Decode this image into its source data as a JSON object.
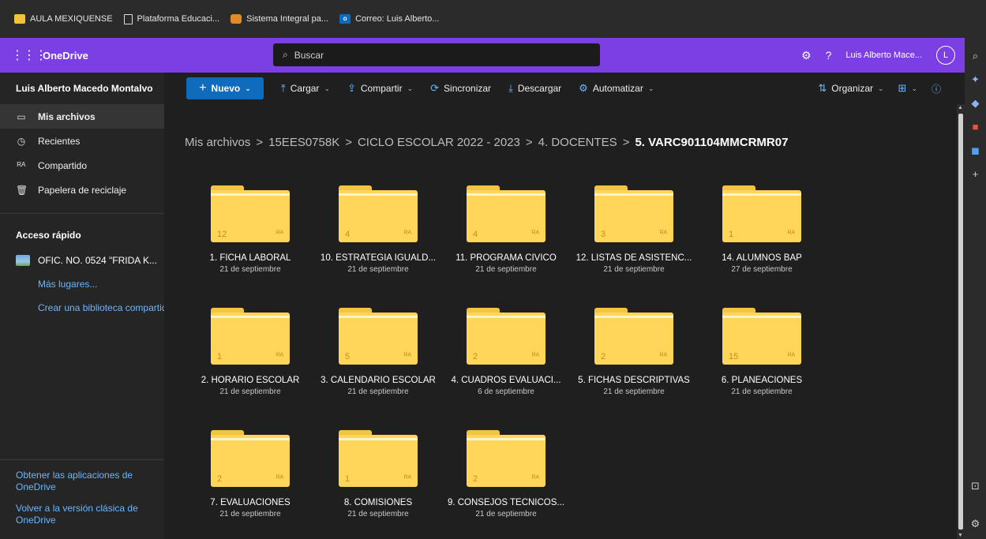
{
  "bookmarks": [
    {
      "label": "AULA MEXIQUENSE",
      "icon": "folder-icon"
    },
    {
      "label": "Plataforma Educaci...",
      "icon": "page-icon"
    },
    {
      "label": "Sistema Integral pa...",
      "icon": "school-icon"
    },
    {
      "label": "Correo: Luis Alberto...",
      "icon": "outlook-icon"
    }
  ],
  "header": {
    "app_name": "OneDrive",
    "search_placeholder": "Buscar",
    "help": "?",
    "user_name": "Luis Alberto Mace...",
    "avatar_initial": "L"
  },
  "sidebar": {
    "user": "Luis Alberto Macedo Montalvo",
    "items": [
      {
        "label": "Mis archivos",
        "icon": "folder-icon",
        "selected": true
      },
      {
        "label": "Recientes",
        "icon": "clock-icon"
      },
      {
        "label": "Compartido",
        "icon": "people-icon"
      },
      {
        "label": "Papelera de reciclaje",
        "icon": "trash-icon"
      }
    ],
    "quick_access_title": "Acceso rápido",
    "quick_item": "OFIC. NO. 0524 \"FRIDA K...",
    "more_places": "Más lugares...",
    "create_library": "Crear una biblioteca compartida",
    "get_apps": "Obtener las aplicaciones de OneDrive",
    "classic": "Volver a la versión clásica de OneDrive"
  },
  "commands": {
    "new": "Nuevo",
    "upload": "Cargar",
    "share": "Compartir",
    "sync": "Sincronizar",
    "download": "Descargar",
    "automate": "Automatizar",
    "organize": "Organizar"
  },
  "breadcrumb": {
    "items": [
      "Mis archivos",
      "15EES0758K",
      "CICLO ESCOLAR 2022 - 2023",
      "4. DOCENTES"
    ],
    "current": "5. VARC901104MMCRMR07"
  },
  "folders": [
    {
      "name": "1. FICHA LABORAL",
      "date": "21 de septiembre",
      "count": "12"
    },
    {
      "name": "10. ESTRATEGIA IGUALD...",
      "date": "21 de septiembre",
      "count": "4"
    },
    {
      "name": "11. PROGRAMA CIVICO",
      "date": "21 de septiembre",
      "count": "4"
    },
    {
      "name": "12. LISTAS DE ASISTENC...",
      "date": "21 de septiembre",
      "count": "3"
    },
    {
      "name": "14. ALUMNOS BAP",
      "date": "27 de septiembre",
      "count": "1"
    },
    {
      "name": "2. HORARIO ESCOLAR",
      "date": "21 de septiembre",
      "count": "1"
    },
    {
      "name": "3. CALENDARIO ESCOLAR",
      "date": "21 de septiembre",
      "count": "5"
    },
    {
      "name": "4. CUADROS EVALUACI...",
      "date": "6 de septiembre",
      "count": "2"
    },
    {
      "name": "5. FICHAS DESCRIPTIVAS",
      "date": "21 de septiembre",
      "count": "2"
    },
    {
      "name": "6. PLANEACIONES",
      "date": "21 de septiembre",
      "count": "15"
    },
    {
      "name": "7. EVALUACIONES",
      "date": "21 de septiembre",
      "count": "2"
    },
    {
      "name": "8. COMISIONES",
      "date": "21 de septiembre",
      "count": "1"
    },
    {
      "name": "9. CONSEJOS TECNICOS...",
      "date": "21 de septiembre",
      "count": "2"
    }
  ]
}
